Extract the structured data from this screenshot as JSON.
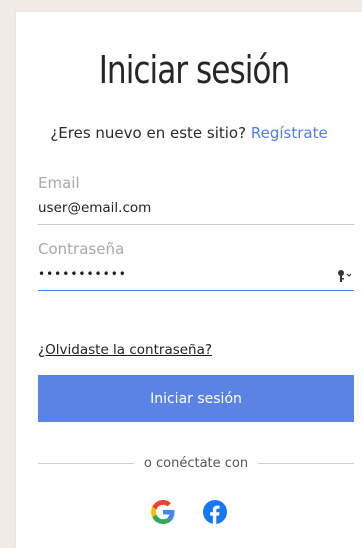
{
  "login": {
    "title": "Iniciar sesión",
    "signup_prompt": "¿Eres nuevo en este sitio?",
    "signup_link": "Regístrate",
    "email": {
      "label": "Email",
      "value": "user@email.com"
    },
    "password": {
      "label": "Contraseña",
      "value": "•••••••••••"
    },
    "forgot_link": "¿Olvidaste la contraseña?",
    "submit_label": "Iniciar sesión",
    "divider_text": "o conéctate con",
    "social": [
      "google-icon",
      "facebook-icon"
    ]
  },
  "colors": {
    "accent": "#4f7ee6",
    "button": "#5b83e3",
    "background": "#f1ebe5",
    "google_blue": "#4285F4",
    "google_red": "#EA4335",
    "google_yellow": "#FBBC05",
    "google_green": "#34A853",
    "facebook": "#1877F2"
  }
}
